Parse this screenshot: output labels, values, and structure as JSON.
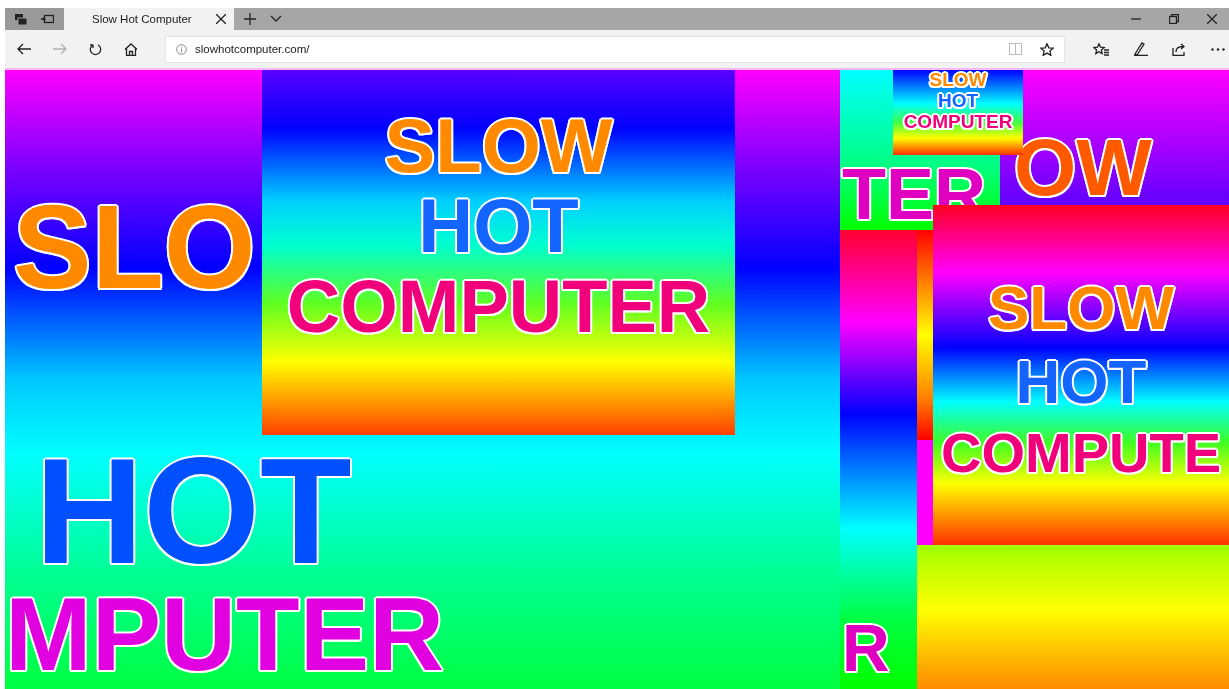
{
  "window": {
    "tabs": [
      {
        "title": "Slow Hot Computer",
        "selected": true
      }
    ]
  },
  "toolbar": {
    "back": {
      "disabled": false
    },
    "forward": {
      "disabled": true
    }
  },
  "address_bar": {
    "url": "slowhotcomputer.com/"
  },
  "page": {
    "panels": [
      {
        "kind": "backdrop",
        "lines": [
          "SLO",
          "HOT",
          "MPUTER"
        ]
      },
      {
        "kind": "banner",
        "lines": [
          "OW"
        ]
      },
      {
        "kind": "tile",
        "lines": [
          "TER"
        ]
      },
      {
        "kind": "strip",
        "lines": [
          "R"
        ]
      },
      {
        "kind": "card-small",
        "lines": [
          "SLOW",
          "HOT",
          "COMPUTER"
        ]
      },
      {
        "kind": "card-main",
        "lines": [
          "SLOW",
          "HOT",
          "COMPUTER"
        ]
      },
      {
        "kind": "card-right",
        "lines": [
          "SLOW",
          "HOT",
          "COMPUTE"
        ]
      }
    ]
  }
}
